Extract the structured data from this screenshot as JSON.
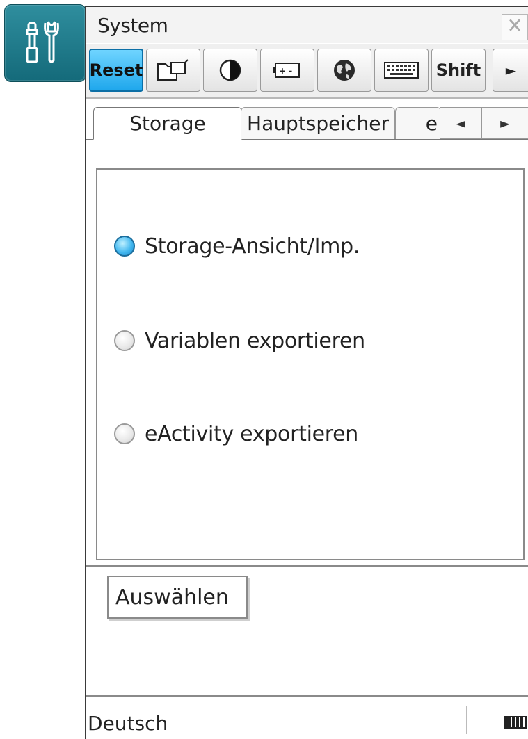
{
  "app": {
    "icon": "tools-icon"
  },
  "window": {
    "title": "System",
    "close_icon": "close-icon"
  },
  "toolbar": {
    "buttons": [
      {
        "label": "Reset",
        "icon": "",
        "active": true
      },
      {
        "label": "",
        "icon": "storage-folder-icon"
      },
      {
        "label": "",
        "icon": "contrast-icon"
      },
      {
        "label": "",
        "icon": "battery-icon"
      },
      {
        "label": "",
        "icon": "globe-icon"
      },
      {
        "label": "",
        "icon": "keyboard-icon"
      },
      {
        "label": "Shift",
        "icon": ""
      },
      {
        "label": "►",
        "icon": "scroll-right-icon"
      }
    ]
  },
  "tabs": {
    "items": [
      {
        "label": "Storage",
        "selected": true
      },
      {
        "label": "Hauptspeicher",
        "selected": false
      },
      {
        "label": "e",
        "selected": false
      }
    ],
    "prev": "◄",
    "next": "►"
  },
  "options": [
    {
      "label": "Storage-Ansicht/Imp.",
      "selected": true
    },
    {
      "label": "Variablen exportieren",
      "selected": false
    },
    {
      "label": "eActivity exportieren",
      "selected": false
    }
  ],
  "action": {
    "select_label": "Auswählen"
  },
  "status": {
    "language": "Deutsch",
    "battery_icon": "battery-full-icon"
  },
  "colors": {
    "active_blue": "#1fa7ec",
    "icon_teal": "#146a7a"
  }
}
